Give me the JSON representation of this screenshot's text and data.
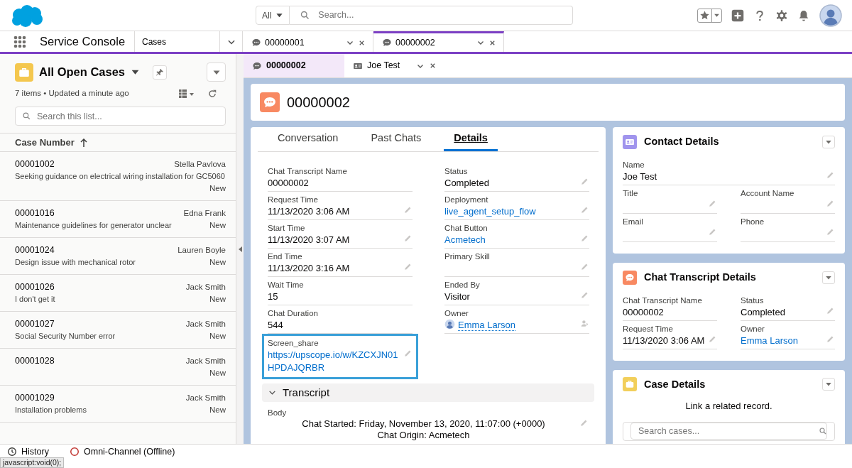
{
  "header": {
    "search_scope": "All",
    "search_placeholder": "Search..."
  },
  "nav": {
    "app_name": "Service Console",
    "object_menu": "Cases",
    "tabs": [
      {
        "label": "00000001",
        "selected": false
      },
      {
        "label": "00000002",
        "selected": true
      }
    ]
  },
  "subtabs": [
    {
      "label": "00000002",
      "kind": "chat",
      "selected": true
    },
    {
      "label": "Joe Test",
      "kind": "contact",
      "selected": false
    }
  ],
  "list_view": {
    "title": "All Open Cases",
    "summary": "7 items • Updated a minute ago",
    "search_placeholder": "Search this list...",
    "column": "Case Number",
    "rows": [
      {
        "number": "00001002",
        "owner": "Stella Pavlova",
        "subject": "Seeking guidance on electrical wiring installation for GC5060",
        "status": "New"
      },
      {
        "number": "00001016",
        "owner": "Edna Frank",
        "subject": "Maintenance guidelines for generator unclear",
        "status": "New"
      },
      {
        "number": "00001024",
        "owner": "Lauren Boyle",
        "subject": "Design issue with mechanical rotor",
        "status": "New"
      },
      {
        "number": "00001026",
        "owner": "Jack Smith",
        "subject": "I don't get it",
        "status": "New"
      },
      {
        "number": "00001027",
        "owner": "Jack Smith",
        "subject": "Social Security Number error",
        "status": "New"
      },
      {
        "number": "00001028",
        "owner": "Jack Smith",
        "status": "New"
      },
      {
        "number": "00001029",
        "owner": "Jack Smith",
        "subject": "Installation problems",
        "status": "New"
      }
    ]
  },
  "record": {
    "title": "00000002",
    "tabs": [
      {
        "label": "Conversation",
        "selected": false
      },
      {
        "label": "Past Chats",
        "selected": false
      },
      {
        "label": "Details",
        "selected": true
      }
    ],
    "fields": [
      {
        "label": "Chat Transcript Name",
        "value": "00000002",
        "kind": "text",
        "editable": false,
        "highlighted": false
      },
      {
        "label": "Status",
        "value": "Completed",
        "kind": "text",
        "editable": true,
        "highlighted": false
      },
      {
        "label": "Request Time",
        "value": "11/13/2020 3:06 AM",
        "kind": "text",
        "editable": true,
        "highlighted": false
      },
      {
        "label": "Deployment",
        "value": "live_agent_setup_flow",
        "kind": "link",
        "editable": true,
        "highlighted": false
      },
      {
        "label": "Start Time",
        "value": "11/13/2020 3:07 AM",
        "kind": "text",
        "editable": true,
        "highlighted": false
      },
      {
        "label": "Chat Button",
        "value": "Acmetech",
        "kind": "link",
        "editable": true,
        "highlighted": false
      },
      {
        "label": "End Time",
        "value": "11/13/2020 3:16 AM",
        "kind": "text",
        "editable": true,
        "highlighted": false
      },
      {
        "label": "Primary Skill",
        "kind": "text",
        "editable": true,
        "highlighted": false
      },
      {
        "label": "Wait Time",
        "value": "15",
        "kind": "text",
        "editable": false,
        "highlighted": false
      },
      {
        "label": "Ended By",
        "value": "Visitor",
        "kind": "text",
        "editable": true,
        "highlighted": false
      },
      {
        "label": "Chat Duration",
        "value": "544",
        "kind": "text",
        "editable": false,
        "highlighted": false
      },
      {
        "label": "Owner",
        "value": "Emma Larson",
        "kind": "user",
        "editable": true,
        "highlighted": false
      },
      {
        "label": "Screen_share",
        "value": "https://upscope.io/w/KZCXJN01HPDAJQRBR",
        "kind": "link",
        "editable": true,
        "highlighted": true
      }
    ],
    "section": {
      "title": "Transcript",
      "expanded": true
    },
    "body_label": "Body",
    "body_lines": [
      "Chat Started: Friday, November 13, 2020, 11:07:00 (+0000)",
      "Chat Origin: Acmetech"
    ]
  },
  "side_cards": [
    {
      "title": "Contact Details",
      "kind": "contact",
      "color": "#a094ed",
      "rows": [
        [
          {
            "label": "Name",
            "value": "Joe Test",
            "kind": "text",
            "editable": true
          }
        ],
        [
          {
            "label": "Title",
            "kind": "text",
            "editable": true
          },
          {
            "label": "Account Name",
            "kind": "text",
            "editable": true
          }
        ],
        [
          {
            "label": "Email",
            "kind": "text",
            "editable": true
          },
          {
            "label": "Phone",
            "kind": "text",
            "editable": true
          }
        ]
      ]
    },
    {
      "title": "Chat Transcript Details",
      "kind": "chat",
      "color": "#f88962",
      "rows": [
        [
          {
            "label": "Chat Transcript Name",
            "value": "00000002",
            "kind": "text",
            "editable": false
          },
          {
            "label": "Status",
            "value": "Completed",
            "kind": "text",
            "editable": true
          }
        ],
        [
          {
            "label": "Request Time",
            "value": "11/13/2020 3:06 AM",
            "kind": "text",
            "editable": true
          },
          {
            "label": "Owner",
            "value": "Emma Larson",
            "kind": "link",
            "editable": true
          }
        ]
      ]
    },
    {
      "title": "Case Details",
      "kind": "case",
      "color": "#f2cf5b",
      "message": "Link a related record.",
      "search_placeholder": "Search cases..."
    }
  ],
  "utility_bar": [
    {
      "label": "History",
      "kind": "history"
    },
    {
      "label": "Omni-Channel (Offline)",
      "kind": "omni"
    }
  ],
  "status_tooltip": "javascript:void(0);"
}
